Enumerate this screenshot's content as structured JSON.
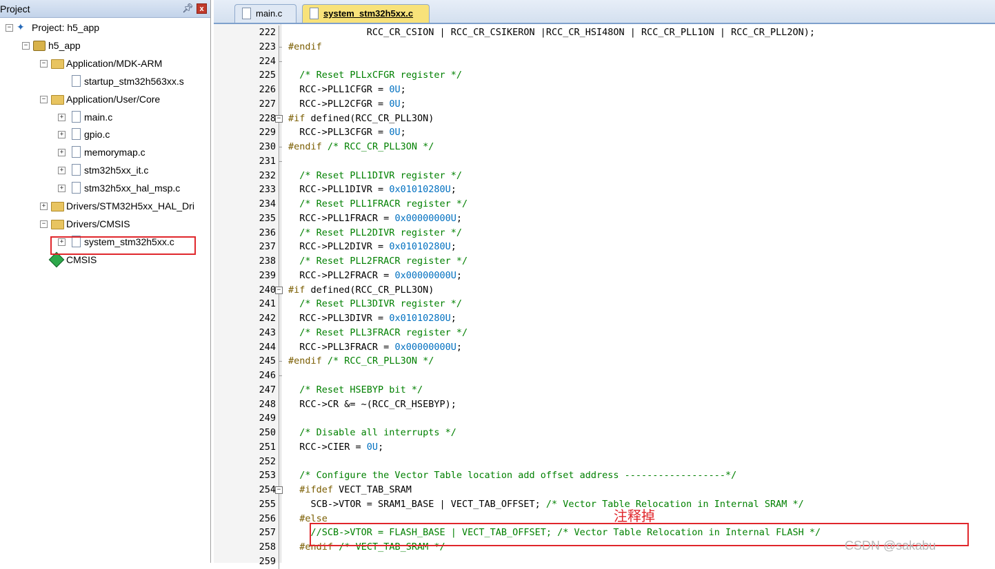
{
  "project_panel": {
    "title": "Project",
    "pin_icon": "pin-icon",
    "close_label": "x",
    "tree": [
      {
        "label": "Project: h5_app",
        "icon": "project-icon",
        "expander": "−"
      },
      {
        "label": "h5_app",
        "icon": "target-icon",
        "expander": "−"
      },
      {
        "label": "Application/MDK-ARM",
        "icon": "folder-icon",
        "expander": "−"
      },
      {
        "label": "startup_stm32h563xx.s",
        "icon": "file-icon",
        "expander": ""
      },
      {
        "label": "Application/User/Core",
        "icon": "folder-icon",
        "expander": "−"
      },
      {
        "label": "main.c",
        "icon": "file-icon",
        "expander": "+"
      },
      {
        "label": "gpio.c",
        "icon": "file-icon",
        "expander": "+"
      },
      {
        "label": "memorymap.c",
        "icon": "file-icon",
        "expander": "+"
      },
      {
        "label": "stm32h5xx_it.c",
        "icon": "file-icon",
        "expander": "+"
      },
      {
        "label": "stm32h5xx_hal_msp.c",
        "icon": "file-icon",
        "expander": "+"
      },
      {
        "label": "Drivers/STM32H5xx_HAL_Dri",
        "icon": "folder-icon",
        "expander": "+"
      },
      {
        "label": "Drivers/CMSIS",
        "icon": "folder-icon",
        "expander": "−"
      },
      {
        "label": "system_stm32h5xx.c",
        "icon": "file-icon",
        "expander": "+"
      },
      {
        "label": "CMSIS",
        "icon": "gem-icon",
        "expander": ""
      }
    ]
  },
  "tabs": [
    {
      "label": "main.c",
      "active": false
    },
    {
      "label": "system_stm32h5xx.c",
      "active": true
    }
  ],
  "code_lines": [
    {
      "n": "222",
      "fold": "line",
      "parts": [
        [
          "plain",
          "              RCC_CR_CSION | RCC_CR_CSIKERON |RCC_CR_HSI48ON | RCC_CR_PLL1ON | RCC_CR_PLL2ON);"
        ]
      ]
    },
    {
      "n": "223",
      "fold": "tick",
      "parts": [
        [
          "pre",
          "#endif"
        ]
      ]
    },
    {
      "n": "224",
      "fold": "tick",
      "parts": []
    },
    {
      "n": "225",
      "fold": "line",
      "parts": [
        [
          "plain",
          "  "
        ],
        [
          "cmt",
          "/* Reset PLLxCFGR register */"
        ]
      ]
    },
    {
      "n": "226",
      "fold": "line",
      "parts": [
        [
          "plain",
          "  RCC->PLL1CFGR = "
        ],
        [
          "num",
          "0U"
        ],
        [
          "plain",
          ";"
        ]
      ]
    },
    {
      "n": "227",
      "fold": "line",
      "parts": [
        [
          "plain",
          "  RCC->PLL2CFGR = "
        ],
        [
          "num",
          "0U"
        ],
        [
          "plain",
          ";"
        ]
      ]
    },
    {
      "n": "228",
      "fold": "box",
      "parts": [
        [
          "pre",
          "#if"
        ],
        [
          "plain",
          " defined(RCC_CR_PLL3ON)"
        ]
      ]
    },
    {
      "n": "229",
      "fold": "line",
      "parts": [
        [
          "plain",
          "  RCC->PLL3CFGR = "
        ],
        [
          "num",
          "0U"
        ],
        [
          "plain",
          ";"
        ]
      ]
    },
    {
      "n": "230",
      "fold": "tick",
      "parts": [
        [
          "pre",
          "#endif"
        ],
        [
          "plain",
          " "
        ],
        [
          "cmt",
          "/* RCC_CR_PLL3ON */"
        ]
      ]
    },
    {
      "n": "231",
      "fold": "tick",
      "parts": []
    },
    {
      "n": "232",
      "fold": "line",
      "parts": [
        [
          "plain",
          "  "
        ],
        [
          "cmt",
          "/* Reset PLL1DIVR register */"
        ]
      ]
    },
    {
      "n": "233",
      "fold": "line",
      "parts": [
        [
          "plain",
          "  RCC->PLL1DIVR = "
        ],
        [
          "num",
          "0x01010280U"
        ],
        [
          "plain",
          ";"
        ]
      ]
    },
    {
      "n": "234",
      "fold": "line",
      "parts": [
        [
          "plain",
          "  "
        ],
        [
          "cmt",
          "/* Reset PLL1FRACR register */"
        ]
      ]
    },
    {
      "n": "235",
      "fold": "line",
      "parts": [
        [
          "plain",
          "  RCC->PLL1FRACR = "
        ],
        [
          "num",
          "0x00000000U"
        ],
        [
          "plain",
          ";"
        ]
      ]
    },
    {
      "n": "236",
      "fold": "line",
      "parts": [
        [
          "plain",
          "  "
        ],
        [
          "cmt",
          "/* Reset PLL2DIVR register */"
        ]
      ]
    },
    {
      "n": "237",
      "fold": "line",
      "parts": [
        [
          "plain",
          "  RCC->PLL2DIVR = "
        ],
        [
          "num",
          "0x01010280U"
        ],
        [
          "plain",
          ";"
        ]
      ]
    },
    {
      "n": "238",
      "fold": "line",
      "parts": [
        [
          "plain",
          "  "
        ],
        [
          "cmt",
          "/* Reset PLL2FRACR register */"
        ]
      ]
    },
    {
      "n": "239",
      "fold": "line",
      "parts": [
        [
          "plain",
          "  RCC->PLL2FRACR = "
        ],
        [
          "num",
          "0x00000000U"
        ],
        [
          "plain",
          ";"
        ]
      ]
    },
    {
      "n": "240",
      "fold": "box",
      "parts": [
        [
          "pre",
          "#if"
        ],
        [
          "plain",
          " defined(RCC_CR_PLL3ON)"
        ]
      ]
    },
    {
      "n": "241",
      "fold": "line",
      "parts": [
        [
          "plain",
          "  "
        ],
        [
          "cmt",
          "/* Reset PLL3DIVR register */"
        ]
      ]
    },
    {
      "n": "242",
      "fold": "line",
      "parts": [
        [
          "plain",
          "  RCC->PLL3DIVR = "
        ],
        [
          "num",
          "0x01010280U"
        ],
        [
          "plain",
          ";"
        ]
      ]
    },
    {
      "n": "243",
      "fold": "line",
      "parts": [
        [
          "plain",
          "  "
        ],
        [
          "cmt",
          "/* Reset PLL3FRACR register */"
        ]
      ]
    },
    {
      "n": "244",
      "fold": "line",
      "parts": [
        [
          "plain",
          "  RCC->PLL3FRACR = "
        ],
        [
          "num",
          "0x00000000U"
        ],
        [
          "plain",
          ";"
        ]
      ]
    },
    {
      "n": "245",
      "fold": "tick",
      "parts": [
        [
          "pre",
          "#endif"
        ],
        [
          "plain",
          " "
        ],
        [
          "cmt",
          "/* RCC_CR_PLL3ON */"
        ]
      ]
    },
    {
      "n": "246",
      "fold": "tick",
      "parts": []
    },
    {
      "n": "247",
      "fold": "line",
      "parts": [
        [
          "plain",
          "  "
        ],
        [
          "cmt",
          "/* Reset HSEBYP bit */"
        ]
      ]
    },
    {
      "n": "248",
      "fold": "line",
      "parts": [
        [
          "plain",
          "  RCC->CR &= ~(RCC_CR_HSEBYP);"
        ]
      ]
    },
    {
      "n": "249",
      "fold": "line",
      "parts": []
    },
    {
      "n": "250",
      "fold": "line",
      "parts": [
        [
          "plain",
          "  "
        ],
        [
          "cmt",
          "/* Disable all interrupts */"
        ]
      ]
    },
    {
      "n": "251",
      "fold": "line",
      "parts": [
        [
          "plain",
          "  RCC->CIER = "
        ],
        [
          "num",
          "0U"
        ],
        [
          "plain",
          ";"
        ]
      ]
    },
    {
      "n": "252",
      "fold": "line",
      "parts": []
    },
    {
      "n": "253",
      "fold": "line",
      "parts": [
        [
          "plain",
          "  "
        ],
        [
          "cmt",
          "/* Configure the Vector Table location add offset address ------------------*/"
        ]
      ]
    },
    {
      "n": "254",
      "fold": "box",
      "parts": [
        [
          "plain",
          "  "
        ],
        [
          "pre",
          "#ifdef"
        ],
        [
          "plain",
          " VECT_TAB_SRAM"
        ]
      ]
    },
    {
      "n": "255",
      "fold": "line",
      "parts": [
        [
          "plain",
          "    SCB->VTOR = SRAM1_BASE | VECT_TAB_OFFSET; "
        ],
        [
          "cmt",
          "/* Vector Table Relocation in Internal SRAM */"
        ]
      ]
    },
    {
      "n": "256",
      "fold": "line",
      "parts": [
        [
          "plain",
          "  "
        ],
        [
          "pre",
          "#else"
        ]
      ]
    },
    {
      "n": "257",
      "fold": "line",
      "parts": [
        [
          "plain",
          "    "
        ],
        [
          "cmt",
          "//SCB->VTOR = FLASH_BASE | VECT_TAB_OFFSET; /* Vector Table Relocation in Internal FLASH */"
        ]
      ]
    },
    {
      "n": "258",
      "fold": "line",
      "parts": [
        [
          "plain",
          "  "
        ],
        [
          "pre",
          "#endif"
        ],
        [
          "plain",
          " "
        ],
        [
          "cmt",
          "/* VECT_TAB_SRAM */"
        ]
      ]
    },
    {
      "n": "259",
      "fold": "line",
      "parts": []
    }
  ],
  "annotation": {
    "text": "注释掉",
    "color": "#e0262b"
  },
  "watermark": "CSDN @sakabu",
  "colors": {
    "preprocessor": "#7a5d00",
    "comment": "#008000",
    "number": "#0070c0",
    "highlight": "#e0262b"
  }
}
